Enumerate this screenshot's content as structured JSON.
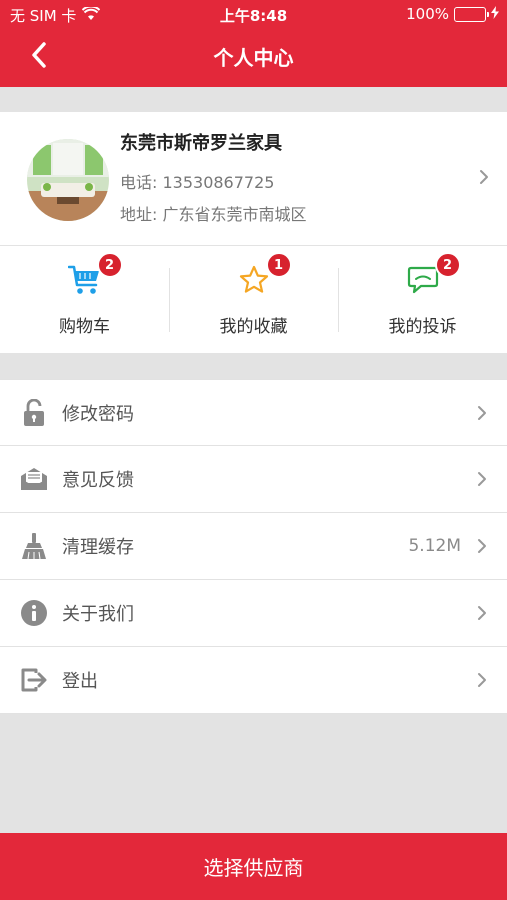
{
  "status_bar": {
    "carrier": "无 SIM 卡",
    "time": "上午8:48",
    "battery": "100%"
  },
  "nav": {
    "title": "个人中心"
  },
  "profile": {
    "company": "东莞市斯帝罗兰家具",
    "phone": "电话: 13530867725",
    "address": "地址: 广东省东莞市南城区"
  },
  "quick_actions": [
    {
      "label": "购物车",
      "badge": "2",
      "icon": "shopping-cart-icon",
      "color": "#1e9fe8"
    },
    {
      "label": "我的收藏",
      "badge": "1",
      "icon": "star-icon",
      "color": "#f5a623"
    },
    {
      "label": "我的投诉",
      "badge": "2",
      "icon": "chat-bubble-icon",
      "color": "#2eaa49"
    }
  ],
  "menu": [
    {
      "label": "修改密码",
      "icon": "lock-icon"
    },
    {
      "label": "意见反馈",
      "icon": "envelope-icon"
    },
    {
      "label": "清理缓存",
      "icon": "broom-icon",
      "value": "5.12M"
    },
    {
      "label": "关于我们",
      "icon": "info-icon"
    },
    {
      "label": "登出",
      "icon": "logout-icon"
    }
  ],
  "bottom_button": {
    "label": "选择供应商"
  },
  "colors": {
    "brand": "#e3283a",
    "badge": "#d7222e",
    "background": "#e3e3e3"
  }
}
